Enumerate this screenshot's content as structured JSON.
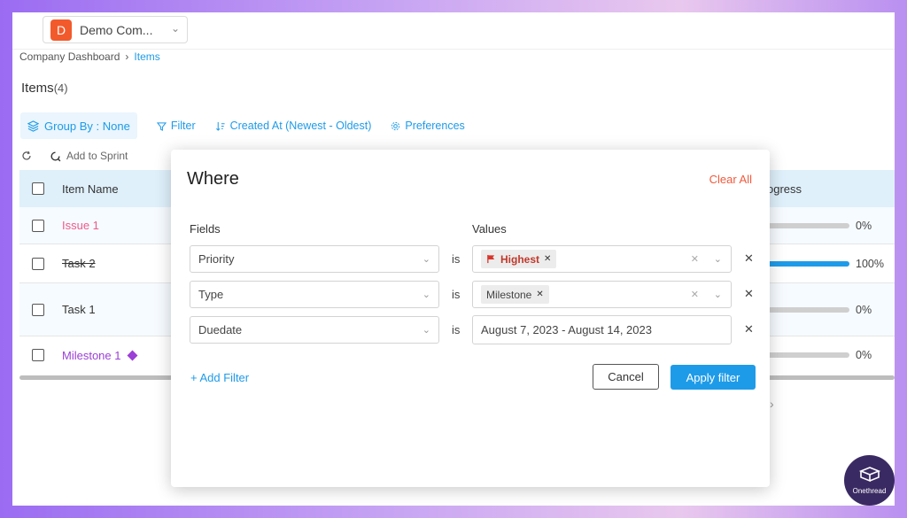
{
  "topbar": {
    "company_initial": "D",
    "company_name": "Demo Com...",
    "company_color": "#f25a2c"
  },
  "breadcrumb": {
    "items": [
      "Company Dashboard",
      "Items"
    ]
  },
  "page": {
    "title": "Items",
    "count": "(4)"
  },
  "toolbar": {
    "group_by": "Group By : None",
    "filter": "Filter",
    "sort": "Created At (Newest - Oldest)",
    "preferences": "Preferences",
    "add_to_sprint": "Add to Sprint"
  },
  "table": {
    "columns": {
      "name": "Item Name",
      "progress": "Progress"
    },
    "rows": [
      {
        "name": "Issue 1",
        "type": "issue",
        "color": "#f0598a",
        "progress": 0,
        "progress_label": "0%"
      },
      {
        "name": "Task 2",
        "type": "task-done",
        "color": "#333333",
        "progress": 100,
        "progress_label": "100%"
      },
      {
        "name": "Task 1",
        "type": "task",
        "color": "#333333",
        "progress": 0,
        "progress_label": "0%"
      },
      {
        "name": "Milestone 1",
        "type": "milestone",
        "color": "#9b3fd6",
        "progress": 0,
        "progress_label": "0%"
      }
    ]
  },
  "modal": {
    "title": "Where",
    "clear_all": "Clear All",
    "fields_label": "Fields",
    "values_label": "Values",
    "operator": "is",
    "filters": [
      {
        "field": "Priority",
        "value_chip": "Highest",
        "chip_type": "priority"
      },
      {
        "field": "Type",
        "value_chip": "Milestone",
        "chip_type": "plain"
      },
      {
        "field": "Duedate",
        "value_text": "August 7, 2023 - August 14, 2023"
      }
    ],
    "add_filter": "+ Add Filter",
    "cancel": "Cancel",
    "apply": "Apply filter"
  },
  "logo": {
    "text": "Onethread"
  },
  "colors": {
    "accent": "#1e9be8",
    "danger": "#f05a3c",
    "header_bg": "#dff0fb"
  },
  "icons": [
    "chevron-down-icon",
    "chevron-right-icon",
    "layers-icon",
    "filter-icon",
    "sort-icon",
    "gear-icon",
    "refresh-icon",
    "sprint-icon",
    "flag-icon",
    "close-icon",
    "diamond-icon"
  ]
}
